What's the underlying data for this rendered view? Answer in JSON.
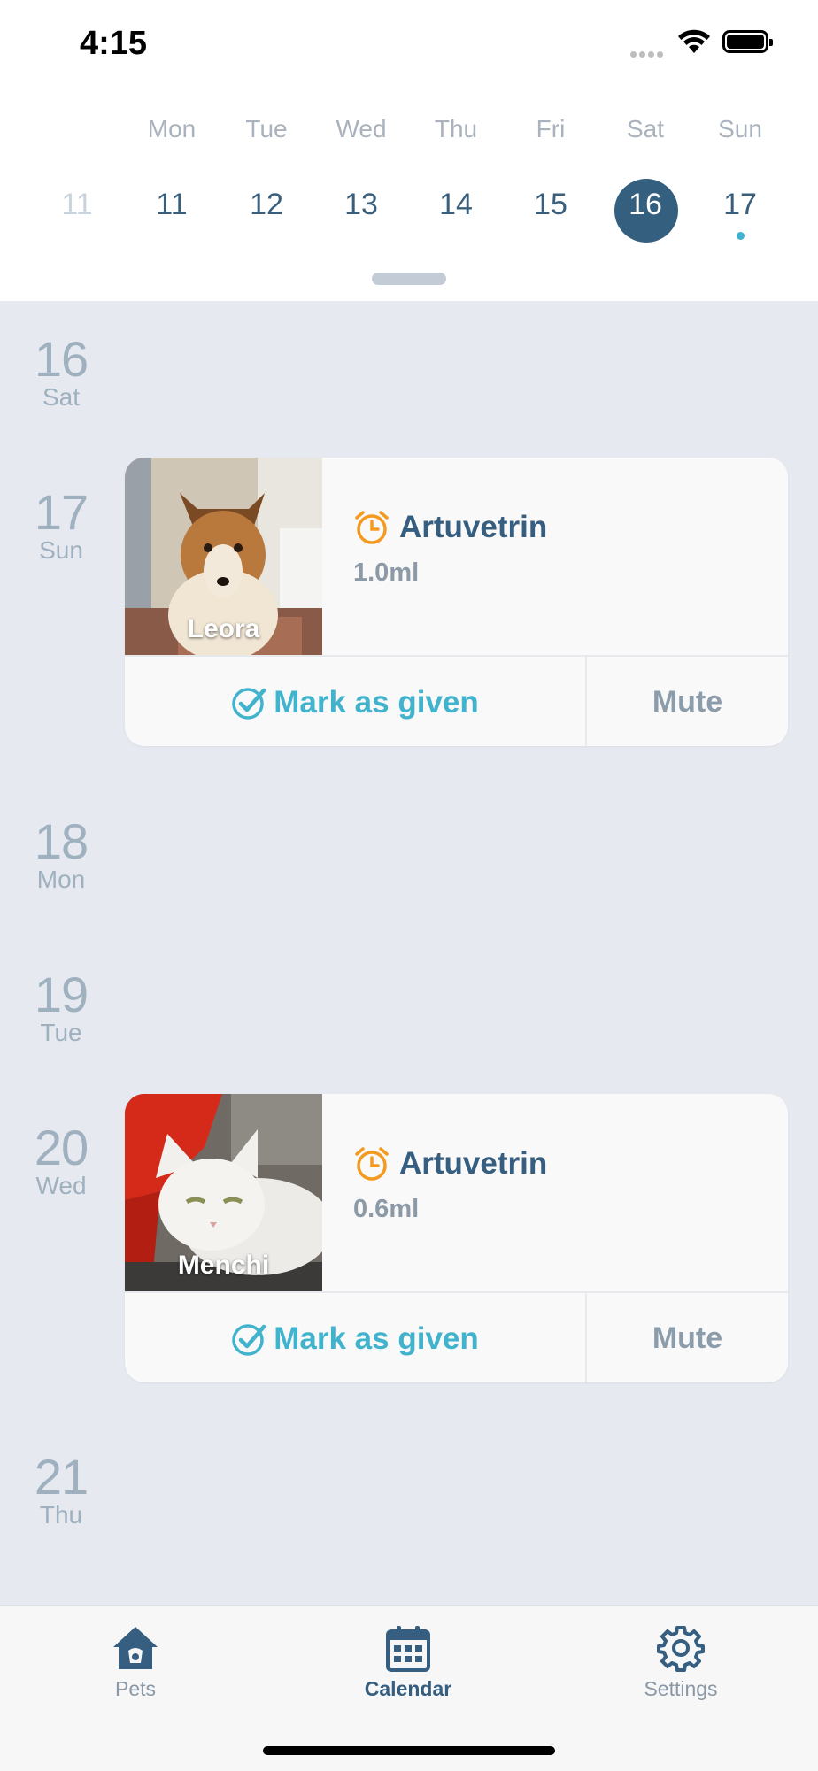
{
  "status_bar": {
    "time": "4:15"
  },
  "week": {
    "days_of_week": [
      "Mon",
      "Tue",
      "Wed",
      "Thu",
      "Fri",
      "Sat",
      "Sun"
    ],
    "prev_date": "11",
    "dates": [
      "11",
      "12",
      "13",
      "14",
      "15",
      "16",
      "17"
    ],
    "selected": "16"
  },
  "timeline": {
    "days": [
      {
        "num": "16",
        "dow": "Sat"
      },
      {
        "num": "17",
        "dow": "Sun"
      },
      {
        "num": "18",
        "dow": "Mon"
      },
      {
        "num": "19",
        "dow": "Tue"
      },
      {
        "num": "20",
        "dow": "Wed"
      },
      {
        "num": "21",
        "dow": "Thu"
      }
    ],
    "cards": [
      {
        "pet": "Leora",
        "medication": "Artuvetrin",
        "dose": "1.0ml",
        "mark_label": "Mark as given",
        "mute_label": "Mute"
      },
      {
        "pet": "Menchi",
        "medication": "Artuvetrin",
        "dose": "0.6ml",
        "mark_label": "Mark as given",
        "mute_label": "Mute"
      }
    ]
  },
  "tabbar": {
    "pets": "Pets",
    "calendar": "Calendar",
    "settings": "Settings",
    "active": "Calendar"
  },
  "colors": {
    "accent": "#345f7f",
    "teal": "#42b3cc",
    "alarm": "#f39a1f",
    "background": "#e6e9f0"
  }
}
